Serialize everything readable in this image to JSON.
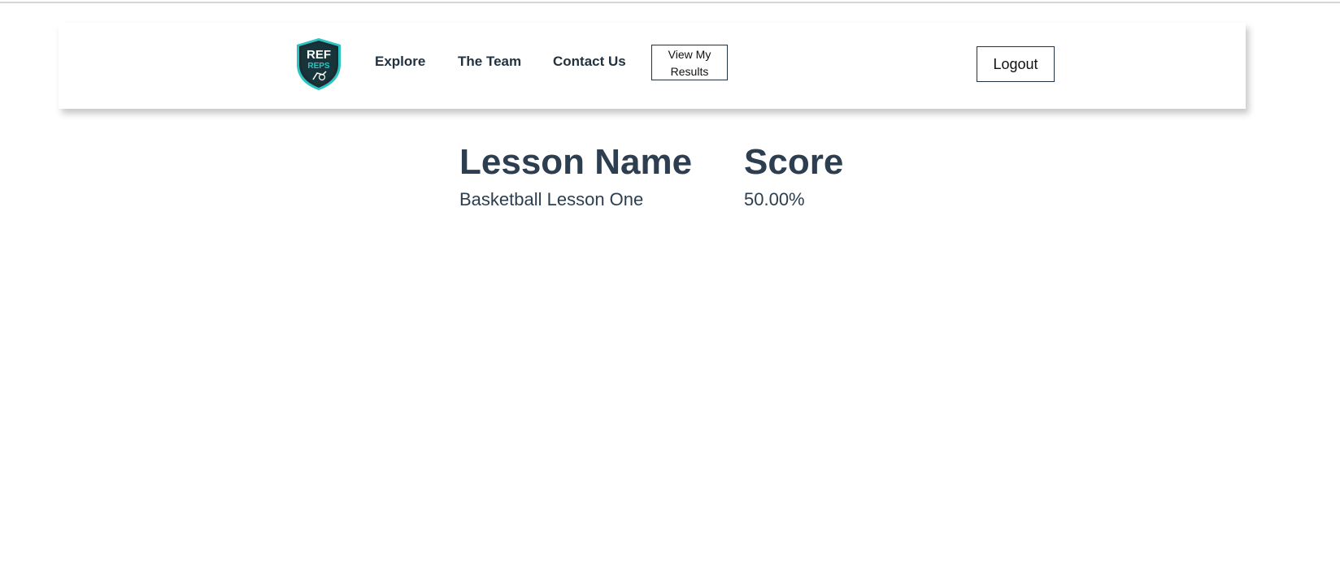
{
  "header": {
    "logo": {
      "icon": "ref-reps-shield-logo",
      "text_top": "REF",
      "text_bottom": "REPS"
    },
    "nav": [
      {
        "label": "Explore"
      },
      {
        "label": "The Team"
      },
      {
        "label": "Contact Us"
      }
    ],
    "results_button": {
      "line1": "View My",
      "line2": "Results"
    },
    "logout_label": "Logout"
  },
  "results": {
    "columns": {
      "lesson": "Lesson Name",
      "score": "Score"
    },
    "rows": [
      {
        "lesson": "Basketball Lesson One",
        "score": "50.00%"
      }
    ]
  },
  "colors": {
    "text": "#2c3e50",
    "nav_text": "#233240",
    "logo_teal": "#2bc4c4",
    "logo_dark": "#1e2a30"
  }
}
